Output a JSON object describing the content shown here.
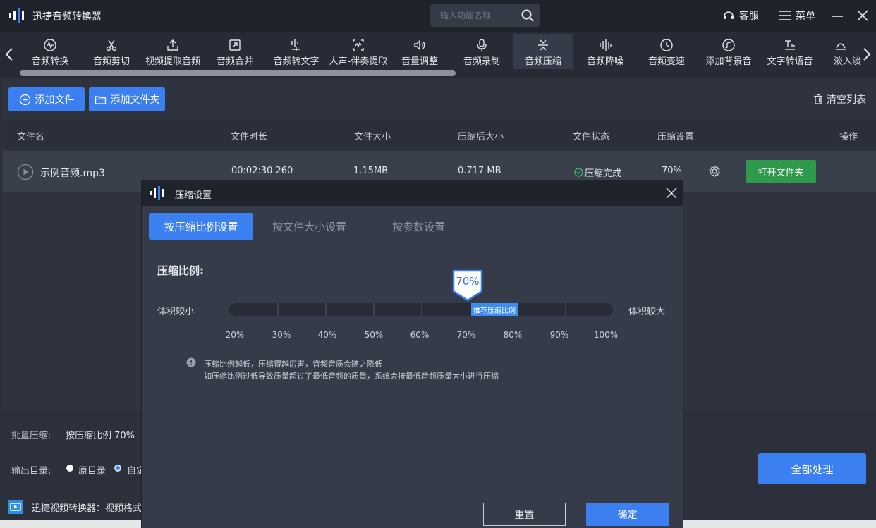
{
  "app": {
    "title": "迅捷音频转换器"
  },
  "search": {
    "placeholder": "输入功能名称"
  },
  "titlebar": {
    "service": "客服",
    "menu": "菜单"
  },
  "tools": [
    {
      "label": "音频转换",
      "icon": "waveform-circle-icon"
    },
    {
      "label": "音频剪切",
      "icon": "scissors-icon"
    },
    {
      "label": "视频提取音频",
      "icon": "export-icon"
    },
    {
      "label": "音频合并",
      "icon": "merge-icon"
    },
    {
      "label": "音频转文字",
      "icon": "audio-to-text-icon"
    },
    {
      "label": "人声-伴奏提取",
      "icon": "vocal-extract-icon"
    },
    {
      "label": "音量调整",
      "icon": "volume-icon"
    },
    {
      "label": "音频录制",
      "icon": "microphone-icon"
    },
    {
      "label": "音频压缩",
      "icon": "compress-icon",
      "active": true
    },
    {
      "label": "音频降噪",
      "icon": "denoise-icon"
    },
    {
      "label": "音频变速",
      "icon": "speed-icon"
    },
    {
      "label": "添加背景音",
      "icon": "background-music-icon"
    },
    {
      "label": "文字转语音",
      "icon": "text-to-speech-icon"
    },
    {
      "label": "淡入淡",
      "icon": "fade-icon"
    }
  ],
  "actions": {
    "add_file": "添加文件",
    "add_folder": "添加文件夹",
    "clear_list": "清空列表"
  },
  "table": {
    "headers": [
      "文件名",
      "文件时长",
      "文件大小",
      "压缩后大小",
      "文件状态",
      "压缩设置",
      "操作"
    ],
    "rows": [
      {
        "name": "示例音频.mp3",
        "duration": "00:02:30.260",
        "size": "1.15MB",
        "compressed_size": "0.717 MB",
        "status": "压缩完成",
        "setting": "70%",
        "action": "打开文件夹"
      }
    ]
  },
  "bottom": {
    "batch_label": "批量压缩:",
    "batch_value": "按压缩比例 70%",
    "output_label": "输出目录:",
    "option_original": "原目录",
    "option_custom": "自定",
    "process_all": "全部处理",
    "promo": "迅捷视频转换器：视频格式"
  },
  "modal": {
    "title": "压缩设置",
    "tabs": [
      "按压缩比例设置",
      "按文件大小设置",
      "按参数设置"
    ],
    "active_tab": 0,
    "ratio_title": "压缩比例:",
    "left_label": "体积较小",
    "right_label": "体积较大",
    "current": "70%",
    "current_value": 70,
    "recommend": "推荐压缩比例",
    "ticks": [
      "20%",
      "30%",
      "40%",
      "50%",
      "60%",
      "70%",
      "80%",
      "90%",
      "100%"
    ],
    "note_line1": "压缩比例越低，压缩得越厉害，音频音质会随之降低",
    "note_line2": "如压缩比例过低导致质量超过了最低音频的质量，系统会按最低音频质量大小进行压缩",
    "reset": "重置",
    "confirm": "确定"
  },
  "colors": {
    "accent": "#3b7ff0",
    "success": "#2e9a4b"
  }
}
